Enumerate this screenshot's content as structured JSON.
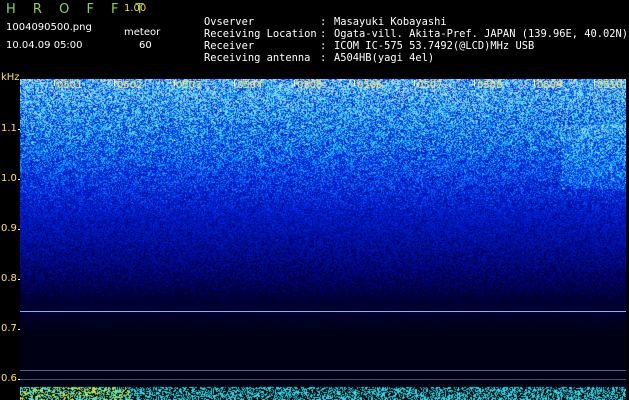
{
  "app": {
    "logo": "H R O F F T",
    "version": "1.00"
  },
  "file": {
    "name": "1004090500.png",
    "datetime": "10.04.09 05:00"
  },
  "meteor": {
    "label": "meteor",
    "count": "60"
  },
  "meta": [
    {
      "key": "Ovserver",
      "value": "Masayuki Kobayashi"
    },
    {
      "key": "Receiving Location",
      "value": "Ogata-vill. Akita-Pref. JAPAN (139.96E, 40.02N)"
    },
    {
      "key": "Receiver",
      "value": "ICOM IC-575 53.7492(@LCD)MHz USB"
    },
    {
      "key": "Receiving antenna",
      "value": "A504HB(yagi 4el)"
    }
  ],
  "axis": {
    "unit": "kHz",
    "y_ticks": [
      "1.1",
      "1.0",
      "0.9",
      "0.8",
      "0.7",
      "0.6"
    ],
    "x_ticks": [
      "0501",
      "0502",
      "0503",
      "0504",
      "0505",
      "0506",
      "0507",
      "0508",
      "0509",
      "0510"
    ]
  },
  "colors": {
    "label": "#ffe15a",
    "logo": "#8fd14f",
    "bg": "#000000",
    "line": "#8db8ff"
  }
}
